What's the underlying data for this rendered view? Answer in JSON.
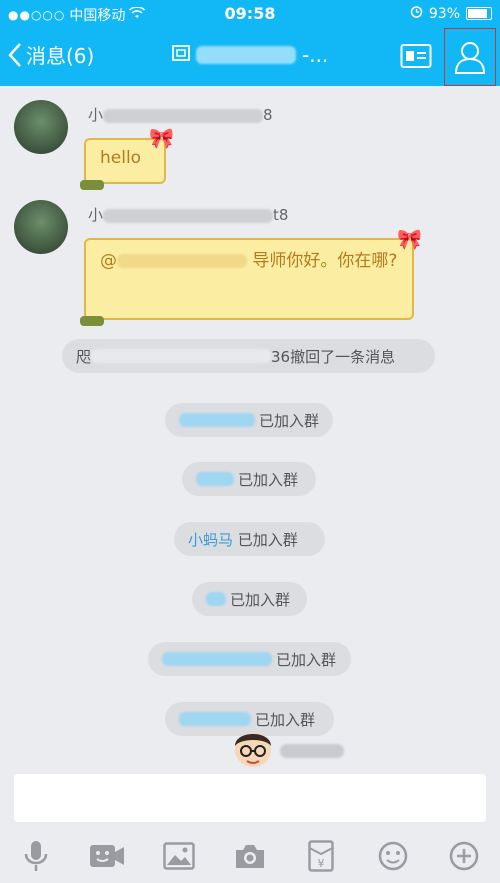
{
  "status_bar": {
    "carrier": "中国移动",
    "time": "09:58",
    "battery": "93%"
  },
  "nav": {
    "back_label": "消息(6)",
    "title_suffix": "-..."
  },
  "messages": [
    {
      "sender_prefix": "小",
      "sender_suffix": "8",
      "text": "hello"
    },
    {
      "sender_prefix": "小",
      "sender_suffix": "t8",
      "text_prefix": "@",
      "text_main": "导师你好。你在哪?"
    }
  ],
  "system_messages": [
    {
      "prefix": "咫",
      "suffix": "36撤回了一条消息"
    },
    {
      "text": "已加入群"
    },
    {
      "text": "已加入群"
    },
    {
      "name": "小蚂马",
      "text": "已加入群"
    },
    {
      "text": "已加入群"
    },
    {
      "text": "已加入群"
    },
    {
      "text": "已加入群"
    }
  ],
  "toolbar": {
    "icons": [
      "microphone-icon",
      "video-icon",
      "image-icon",
      "camera-icon",
      "red-packet-icon",
      "emoji-icon",
      "plus-icon"
    ]
  },
  "colors": {
    "accent": "#12b7f5",
    "bubble": "#fbeea3",
    "bubble_border": "#e0b84a",
    "bubble_text": "#b47a1c",
    "background": "#ebecf0"
  }
}
